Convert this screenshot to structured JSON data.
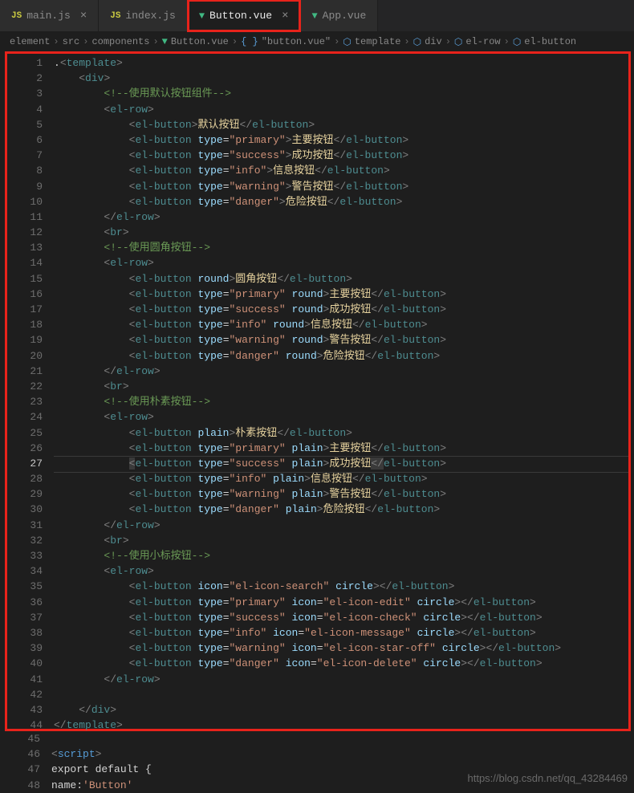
{
  "tabs": [
    {
      "icon": "js",
      "label": "main.js",
      "close": "×"
    },
    {
      "icon": "js",
      "label": "index.js",
      "close": ""
    },
    {
      "icon": "vue",
      "label": "Button.vue",
      "close": "×",
      "active": true,
      "highlighted": true
    },
    {
      "icon": "vue",
      "label": "App.vue",
      "close": ""
    }
  ],
  "breadcrumb": {
    "parts": [
      "element",
      "src",
      "components",
      "Button.vue",
      "\"button.vue\"",
      "template",
      "div",
      "el-row",
      "el-button"
    ]
  },
  "code_lines": [
    ".<template>",
    "    <div>",
    "        <!--使用默认按钮组件-->",
    "        <el-row>",
    "            <el-button>默认按钮</el-button>",
    "            <el-button type=\"primary\">主要按钮</el-button>",
    "            <el-button type=\"success\">成功按钮</el-button>",
    "            <el-button type=\"info\">信息按钮</el-button>",
    "            <el-button type=\"warning\">警告按钮</el-button>",
    "            <el-button type=\"danger\">危险按钮</el-button>",
    "        </el-row>",
    "        <br>",
    "        <!--使用圆角按钮-->",
    "        <el-row>",
    "            <el-button round>圆角按钮</el-button>",
    "            <el-button type=\"primary\" round>主要按钮</el-button>",
    "            <el-button type=\"success\" round>成功按钮</el-button>",
    "            <el-button type=\"info\" round>信息按钮</el-button>",
    "            <el-button type=\"warning\" round>警告按钮</el-button>",
    "            <el-button type=\"danger\" round>危险按钮</el-button>",
    "        </el-row>",
    "        <br>",
    "        <!--使用朴素按钮-->",
    "        <el-row>",
    "            <el-button plain>朴素按钮</el-button>",
    "            <el-button type=\"primary\" plain>主要按钮</el-button>",
    "            <el-button type=\"success\" plain>成功按钮</el-button>",
    "            <el-button type=\"info\" plain>信息按钮</el-button>",
    "            <el-button type=\"warning\" plain>警告按钮</el-button>",
    "            <el-button type=\"danger\" plain>危险按钮</el-button>",
    "        </el-row>",
    "        <br>",
    "        <!--使用小标按钮-->",
    "        <el-row>",
    "            <el-button icon=\"el-icon-search\" circle></el-button>",
    "            <el-button type=\"primary\" icon=\"el-icon-edit\" circle></el-button>",
    "            <el-button type=\"success\" icon=\"el-icon-check\" circle></el-button>",
    "            <el-button type=\"info\" icon=\"el-icon-message\" circle></el-button>",
    "            <el-button type=\"warning\" icon=\"el-icon-star-off\" circle></el-button>",
    "            <el-button type=\"danger\" icon=\"el-icon-delete\" circle></el-button>",
    "        </el-row>",
    "",
    "    </div>",
    "</template>"
  ],
  "extra_lines": {
    "l45": "",
    "l46": "<script>",
    "l47": "export default {",
    "l48": "    name:'Button'"
  },
  "current_line": 27,
  "watermark": "https://blog.csdn.net/qq_43284469"
}
